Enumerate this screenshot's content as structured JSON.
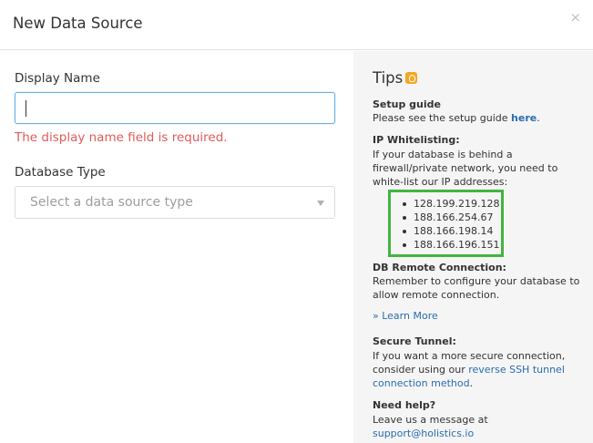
{
  "modal": {
    "title": "New Data Source",
    "close_glyph": "×"
  },
  "form": {
    "display_name": {
      "label": "Display Name",
      "value": "",
      "error": "The display name field is required."
    },
    "database_type": {
      "label": "Database Type",
      "placeholder": "Select a data source type"
    }
  },
  "tips": {
    "title": "Tips",
    "icon": "lightbulb-icon",
    "setup": {
      "heading": "Setup guide",
      "text_before": "Please see the setup guide",
      "link": "here",
      "text_after": "."
    },
    "whitelist": {
      "heading": "IP Whitelisting:",
      "text": "If your database is behind a firewall/private network, you need to white-list our IP addresses:",
      "ips": [
        "128.199.219.128",
        "188.166.254.67",
        "188.166.198.14",
        "188.166.196.151"
      ]
    },
    "remote": {
      "heading": "DB Remote Connection:",
      "text": "Remember to configure your database to allow remote connection.",
      "link": "» Learn More"
    },
    "tunnel": {
      "heading": "Secure Tunnel:",
      "text_before": "If you want a more secure connection, consider using our",
      "link": "reverse SSH tunnel connection method",
      "text_after": "."
    },
    "help": {
      "heading": "Need help?",
      "text_before": "Leave us a message at",
      "link": "support@holistics.io"
    }
  },
  "colors": {
    "error": "#e05a5a",
    "focus_border": "#66afe9",
    "link": "#2a6db0",
    "highlight_box": "#41b541",
    "tips_icon": "#f5a623"
  }
}
